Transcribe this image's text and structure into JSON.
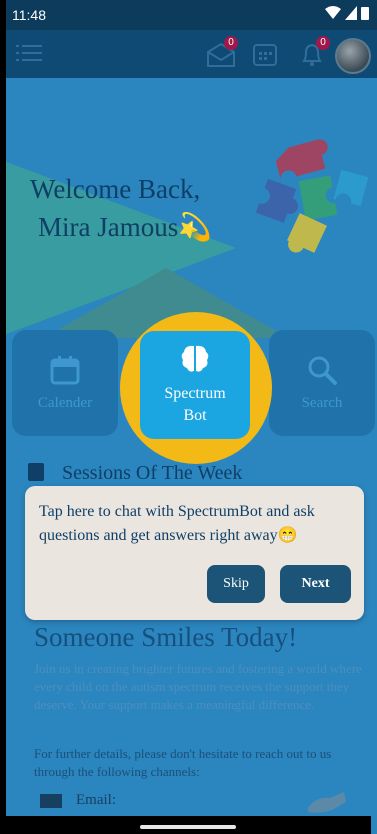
{
  "status": {
    "time": "11:48"
  },
  "appbar": {
    "menu_icon": "hamburger-icon",
    "mail_badge": "0",
    "notif_badge": "0"
  },
  "welcome": {
    "line1": "Welcome Back,",
    "line2": "Mira Jamous💫"
  },
  "cards": {
    "calendar": "Calender",
    "bot_line1": "Spectrum",
    "bot_line2": "Bot",
    "search": "Search"
  },
  "sessions_title": "Sessions Of The Week",
  "tip": {
    "message": "Tap here to chat with SpectrumBot and ask questions and get answers right away😁",
    "skip": "Skip",
    "next": "Next"
  },
  "smiles_title": "Someone Smiles Today!",
  "join_text": "Join us in creating brighter futures and fostering a world where every child on the autism spectrum receives the support they deserve. Your support makes a meaningful difference.",
  "further_text": "For further details, please don't hesitate to reach out to us through the following channels:",
  "email_label": "Email:"
}
